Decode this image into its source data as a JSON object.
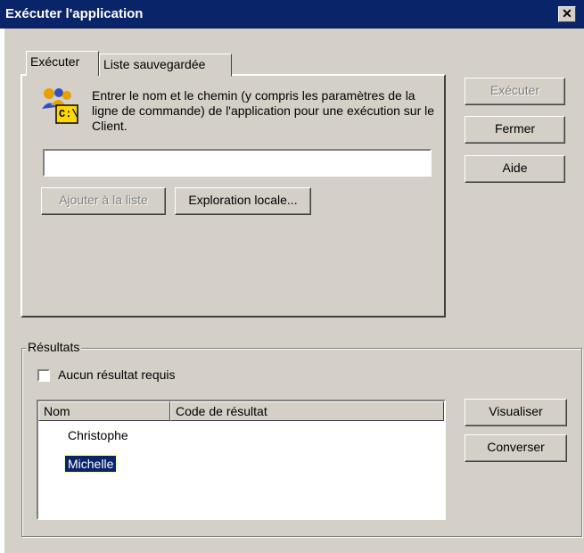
{
  "window": {
    "title": "Exécuter l'application",
    "close_glyph": "✕"
  },
  "tabs": [
    {
      "label": "Exécuter",
      "active": true
    },
    {
      "label": "Liste sauvegardée",
      "active": false
    }
  ],
  "run_panel": {
    "icon": "run-application-icon",
    "icon_text": "C:\\",
    "description": "Entrer le nom et le chemin (y compris les paramètres de la ligne de commande) de l'application pour une exécution sur le Client.",
    "command_value": "",
    "add_to_list_label": "Ajouter à la liste",
    "local_browse_label": "Exploration locale..."
  },
  "side_buttons": {
    "execute_label": "Exécuter",
    "close_label": "Fermer",
    "help_label": "Aide"
  },
  "results": {
    "group_label": "Résultats",
    "no_result_label": "Aucun résultat requis",
    "no_result_checked": false,
    "columns": [
      "Nom",
      "Code de résultat"
    ],
    "rows": [
      {
        "name": "Christophe",
        "code": "",
        "selected": false
      },
      {
        "name": "Michelle",
        "code": "",
        "selected": true
      }
    ],
    "view_label": "Visualiser",
    "chat_label": "Converser"
  },
  "colors": {
    "title_bg": "#0a246a",
    "face": "#d4d0c8",
    "selection": "#0a246a"
  }
}
